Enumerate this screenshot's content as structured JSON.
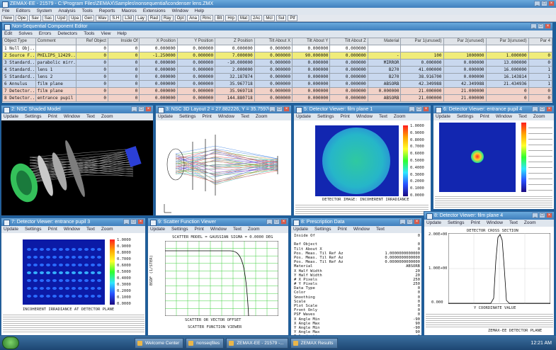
{
  "main_title": "ZEMAX-EE - 21579 - C:\\Program Files\\ZEMAX\\Samples\\nonsequential\\condenser lens.ZMX",
  "main_menu": [
    "File",
    "Editors",
    "System",
    "Analysis",
    "Tools",
    "Reports",
    "Macros",
    "Extensions",
    "Window",
    "Help"
  ],
  "main_toolbar": [
    "New",
    "Ope",
    "Sav",
    "Sas",
    "Upd",
    "Upa",
    "Gen",
    "Wav",
    "S.H",
    "L3d",
    "Lay",
    "Rad",
    "Ray",
    "Opt",
    "Ana",
    "Rmc",
    "Blt",
    "Hrp",
    "Mat",
    "2Ac",
    "Mcl",
    "Sul",
    "Ptf"
  ],
  "nsce": {
    "title": "Non-Sequential Component Editor",
    "menu": [
      "Edit",
      "Solves",
      "Errors",
      "Detectors",
      "Tools",
      "View",
      "Help"
    ],
    "headers": [
      "Object Type",
      "Comment",
      "Ref Object",
      "Inside Of",
      "X Position",
      "Y Position",
      "Z Position",
      "Tilt About X",
      "Tilt About Y",
      "Tilt About Z",
      "Material",
      "Par 1(unused)",
      "Par 2(unused)",
      "Par 3(unused)",
      "Par 4"
    ],
    "rows": [
      [
        "1 Null Obj...",
        "",
        "0",
        "0",
        "0.000000",
        "0.000000",
        "0.000000",
        "0.000000",
        "0.000000",
        "0.000000",
        "",
        "",
        "",
        "",
        ""
      ],
      [
        "2 Source F...",
        "PHILIPS_12429...",
        "0",
        "0",
        "-1.250000",
        "0.000000",
        "7.000000",
        "0.000000",
        "90.000000",
        "0.000000",
        "-",
        "100",
        "1000000",
        "1.000000",
        "0"
      ],
      [
        "3 Standard...",
        "parabolic mirr...",
        "0",
        "0",
        "0.000000",
        "0.000000",
        "-10.000000",
        "0.000000",
        "0.000000",
        "0.000000",
        "MIRROR",
        "0.000000",
        "0.000000",
        "13.000000",
        "0"
      ],
      [
        "4 Standard...",
        "lens 1",
        "0",
        "0",
        "0.000000",
        "0.000000",
        "2.000000",
        "0.000000",
        "0.000000",
        "0.000000",
        "B270",
        "41.000000",
        "0.000000",
        "16.000000",
        "1"
      ],
      [
        "5 Standard...",
        "lens 2",
        "0",
        "0",
        "0.000000",
        "0.000000",
        "32.187874",
        "0.000000",
        "0.000000",
        "0.000000",
        "B270",
        "38.916700",
        "0.000000",
        "16.143814",
        "1"
      ],
      [
        "6 Annulus",
        "film plane",
        "0",
        "0",
        "0.000000",
        "0.000000",
        "35.967718",
        "0.000000",
        "0.000000",
        "0.000000",
        "ABSORB",
        "42.349988",
        "42.349988",
        "21.434936",
        "1"
      ],
      [
        "7 Detector...",
        "film plane",
        "0",
        "0",
        "0.000000",
        "0.000000",
        "35.969718",
        "0.000000",
        "0.000000",
        "0.000000",
        "0.000000",
        "21.000000",
        "21.000000",
        "0",
        "0"
      ],
      [
        "8 Detector...",
        "entrance pupil",
        "0",
        "0",
        "0.000000",
        "0.000000",
        "144.880718",
        "0.000000",
        "0.000000",
        "0.000000",
        "ABSORB",
        "21.000000",
        "21.000000",
        "0",
        "0"
      ]
    ]
  },
  "std_menu": [
    "Update",
    "Settings",
    "Print",
    "Window",
    "Text",
    "Zoom"
  ],
  "det_menu": [
    "Update",
    "Settings",
    "Print",
    "Window",
    "Text",
    "Zoom"
  ],
  "w_shaded": {
    "title": "2: NSC Shaded Model"
  },
  "w_layout": {
    "title": "3: NSC 3D Layout 2 = 27.882226, Y = 35.759767"
  },
  "w_det1": {
    "title": "5: Detector Viewer: film plane 1",
    "caption": "DETECTOR IMAGE: INCOHERENT IRRADIANCE",
    "legend": [
      "1.0000",
      "0.9000",
      "0.8000",
      "0.7000",
      "0.6000",
      "0.5000",
      "0.4000",
      "0.3000",
      "0.2000",
      "0.1000",
      "0.0000"
    ]
  },
  "w_det2": {
    "title": "6: Detector Viewer: entrance pupil 4"
  },
  "w_det3": {
    "title": "7: Detector Viewer: entrance pupil 3",
    "caption": "INCOHERENT IRRADIANCE AT DETECTOR PLANE",
    "legend": [
      "1.0000",
      "0.9000",
      "0.8000",
      "0.7000",
      "0.6000",
      "0.5000",
      "0.4000",
      "0.3000",
      "0.2000",
      "0.1000",
      "0.0000"
    ]
  },
  "w_scatter": {
    "title": "9: Scatter Function Viewer",
    "menu": [
      "Update",
      "Settings",
      "Print",
      "Window",
      "Text",
      "Zoom"
    ],
    "plot_title": "SCATTER MODEL = GAUSSIAN  SIGMA = 0.0000 DEG",
    "ylabel": "BSDF (1/STER)",
    "xlabel": "SCATTER OR VECTOR OFFSET",
    "caption": "SCATTER FUNCTION VIEWER"
  },
  "w_presc": {
    "title": "8: Prescription Data",
    "menu": [
      "Update",
      "Settings",
      "Print",
      "Window",
      "Text"
    ],
    "lines": [
      [
        "Inside Of",
        "0"
      ],
      [
        "",
        ""
      ],
      [
        "Ref Object",
        "0"
      ],
      [
        "Tilt About X",
        "0"
      ],
      [
        "Pos. Meas. Til Ref Az",
        "1.0000000000000"
      ],
      [
        "Pos. Meas. Til Ref Az",
        "0.0000000000000"
      ],
      [
        "Pos. Meas. Til Ref Az",
        "0.0000000000000"
      ],
      [
        "Material",
        "ABSORB"
      ],
      [
        "X Half Width",
        "20"
      ],
      [
        "Y Half Width",
        "20"
      ],
      [
        "# X Pixels",
        "250"
      ],
      [
        "# Y Pixels",
        "250"
      ],
      [
        "Data Type",
        "0"
      ],
      [
        "Color",
        "0"
      ],
      [
        "Smoothing",
        "0"
      ],
      [
        "Scale",
        "0"
      ],
      [
        "Plot Scale",
        "0"
      ],
      [
        "Front Only",
        "0"
      ],
      [
        "PSF Waves",
        "0"
      ],
      [
        "X Angle Min",
        "-90"
      ],
      [
        "X Angle Max",
        "90"
      ],
      [
        "Y Angle Min",
        "-90"
      ],
      [
        "Y Angle Max",
        "90"
      ],
      [
        "Polarization",
        "0"
      ]
    ]
  },
  "w_det4": {
    "title": "8: Detector Viewer: film plane 4",
    "plot_title": "DETECTOR CROSS SECTION",
    "xlabel": "Y COORDINATE VALUE",
    "yticks": [
      "2.00E+00",
      "1.00E+00",
      "0.000"
    ],
    "footer": "ZEMAX-EE  DETECTOR PLANE"
  },
  "taskbar": {
    "items": [
      "Welcome Center",
      "nonseqfiles",
      "ZEMAX-EE - 21579 -...",
      "ZEMAX Results"
    ],
    "clock": "12:21 AM"
  }
}
